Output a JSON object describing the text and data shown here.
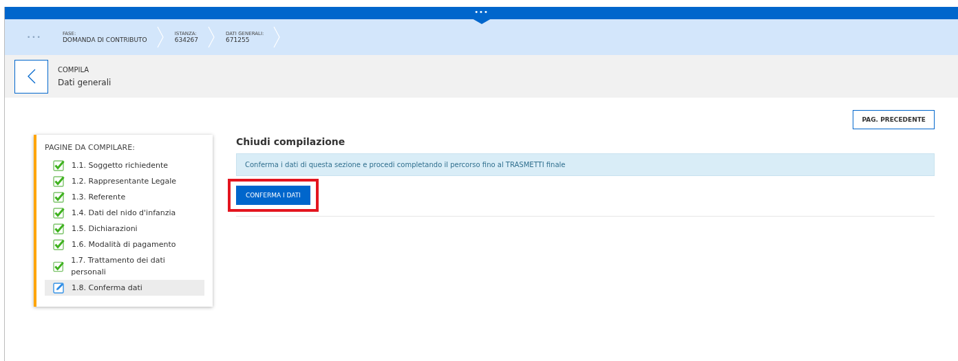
{
  "top_bar": {
    "handle": "•••"
  },
  "breadcrumb": {
    "more": "•••",
    "steps": [
      {
        "label": "FASE:",
        "value": "DOMANDA DI CONTRIBUTO"
      },
      {
        "label": "ISTANZA:",
        "value": "634267"
      },
      {
        "label": "DATI GENERALI:",
        "value": "671255"
      }
    ]
  },
  "header": {
    "overline": "COMPILA",
    "title": "Dati generali"
  },
  "prev_button": "PAG. PRECEDENTE",
  "pages": {
    "title": "PAGINE DA COMPILARE:",
    "items": [
      {
        "label": "1.1. Soggetto richiedente",
        "kind": "done",
        "selected": false
      },
      {
        "label": "1.2. Rappresentante Legale",
        "kind": "done",
        "selected": false
      },
      {
        "label": "1.3. Referente",
        "kind": "done",
        "selected": false
      },
      {
        "label": "1.4. Dati del nido d'infanzia",
        "kind": "done",
        "selected": false
      },
      {
        "label": "1.5. Dichiarazioni",
        "kind": "done",
        "selected": false
      },
      {
        "label": "1.6. Modalità di pagamento",
        "kind": "done",
        "selected": false
      },
      {
        "label": "1.7. Trattamento dei dati personali",
        "kind": "done",
        "selected": false
      },
      {
        "label": "1.8. Conferma dati",
        "kind": "editing",
        "selected": true
      }
    ]
  },
  "section": {
    "title": "Chiudi compilazione",
    "info": "Conferma i dati di questa sezione e procedi completando il percorso fino al TRASMETTI finale",
    "button": "CONFERMA I DATI",
    "highlighted": true
  }
}
